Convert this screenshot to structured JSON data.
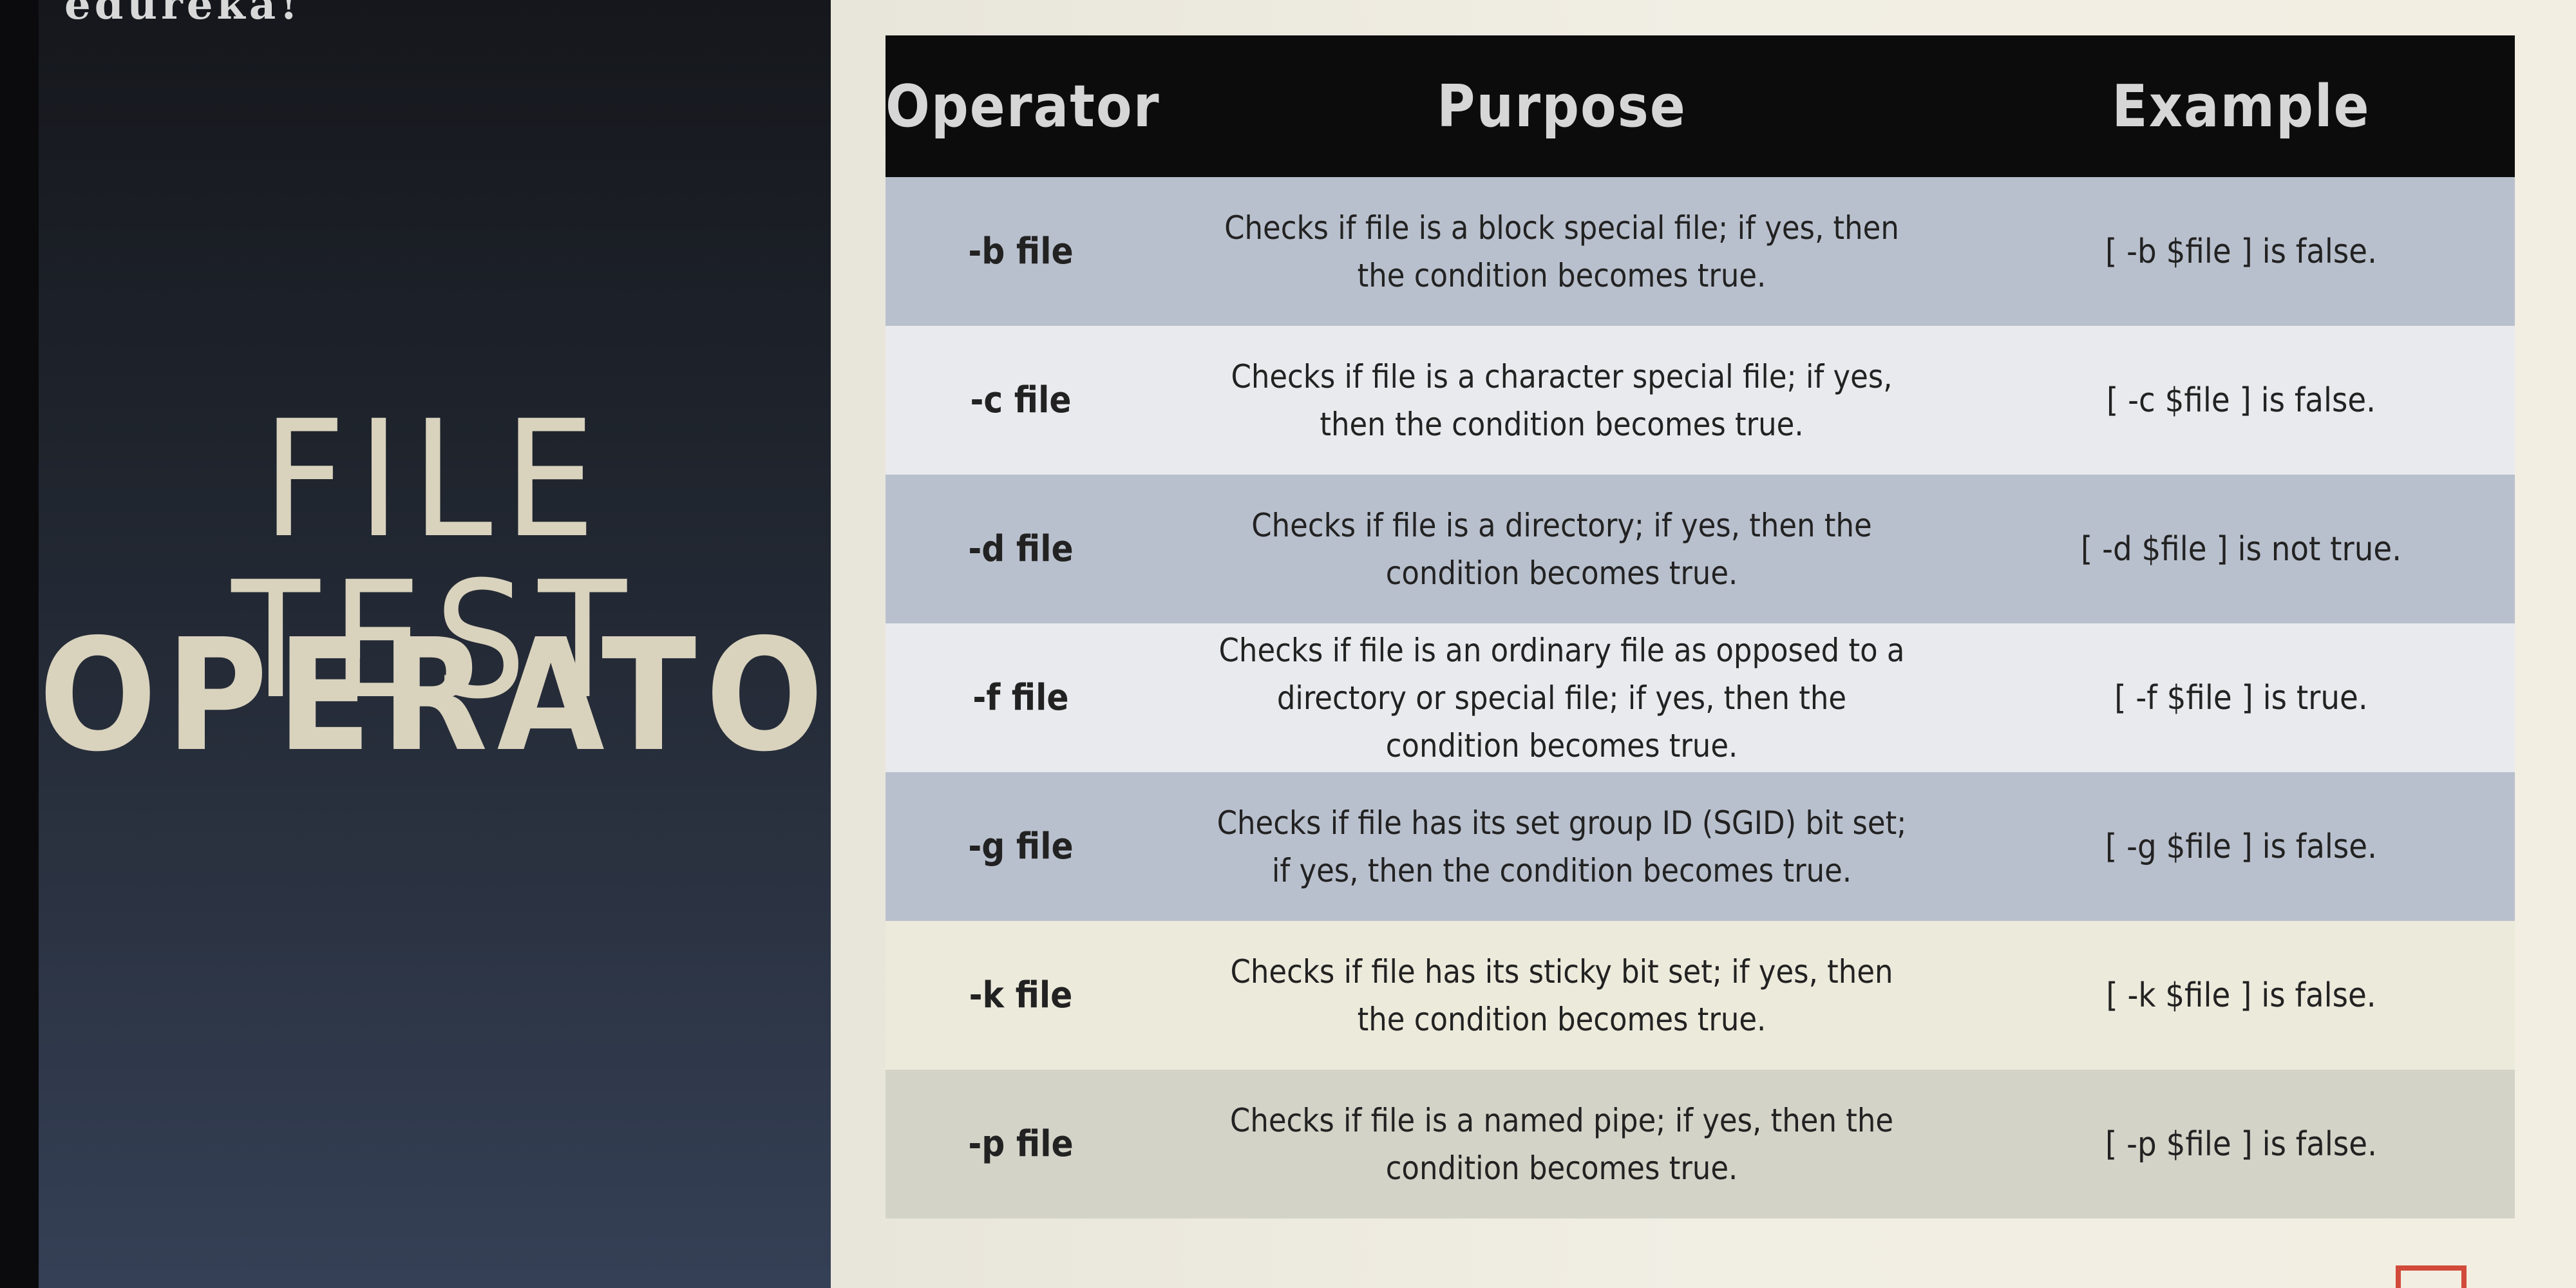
{
  "brand": "edureka!",
  "title": {
    "line1": "FILE TEST",
    "line2": "OPERATORS"
  },
  "table": {
    "headers": [
      "Operator",
      "Purpose",
      "Example"
    ],
    "rows": [
      {
        "operator": "-b file",
        "purpose": "Checks if file is a block special file; if yes, then the condition becomes true.",
        "example": "[ -b $file ] is false."
      },
      {
        "operator": "-c file",
        "purpose": "Checks if file is a character special file; if yes, then the condition becomes true.",
        "example": "[ -c $file ] is false."
      },
      {
        "operator": "-d file",
        "purpose": "Checks if file is a directory; if yes, then the condition becomes true.",
        "example": "[ -d $file ] is not true."
      },
      {
        "operator": "-f file",
        "purpose": "Checks if file is an ordinary file as opposed to a directory or special file; if yes, then the condition becomes true.",
        "example": "[ -f $file ] is true."
      },
      {
        "operator": "-g file",
        "purpose": "Checks if file has its set group ID (SGID) bit set; if yes, then the condition becomes true.",
        "example": "[ -g $file ] is false."
      },
      {
        "operator": "-k file",
        "purpose": "Checks if file has its sticky bit set; if yes, then the condition becomes true.",
        "example": "[ -k $file ] is false."
      },
      {
        "operator": "-p file",
        "purpose": "Checks if file is a named pipe; if yes, then the condition becomes true.",
        "example": "[ -p $file ] is false."
      }
    ]
  },
  "colors": {
    "header_bg": "#0c0c0c",
    "title_text": "#d9d2bd",
    "accent_mark": "#d24a3a"
  }
}
